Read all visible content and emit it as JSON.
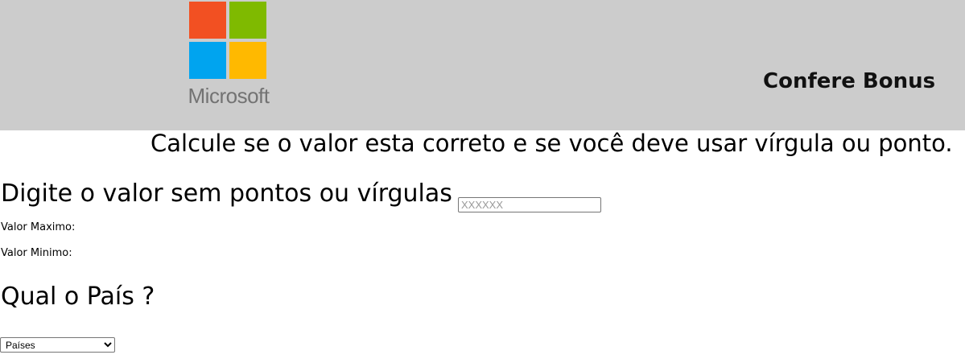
{
  "header": {
    "logo_text": "Microsoft",
    "logo_colors": [
      "#f25022",
      "#7fba00",
      "#00a4ef",
      "#ffb900"
    ],
    "title": "Confere Bonus",
    "background": "#cccccc"
  },
  "main": {
    "subtitle": "Calcule se o valor esta correto e se você deve usar vírgula ou ponto.",
    "value_label": "Digite o valor sem pontos ou vírgulas",
    "value_input": {
      "value": "",
      "placeholder": "XXXXXX"
    },
    "max_label": "Valor Maximo:",
    "max_value": "",
    "min_label": "Valor Minimo:",
    "min_value": "",
    "country_heading": "Qual o País ?",
    "country_select": {
      "selected": "Países",
      "options": [
        "Países"
      ]
    }
  }
}
